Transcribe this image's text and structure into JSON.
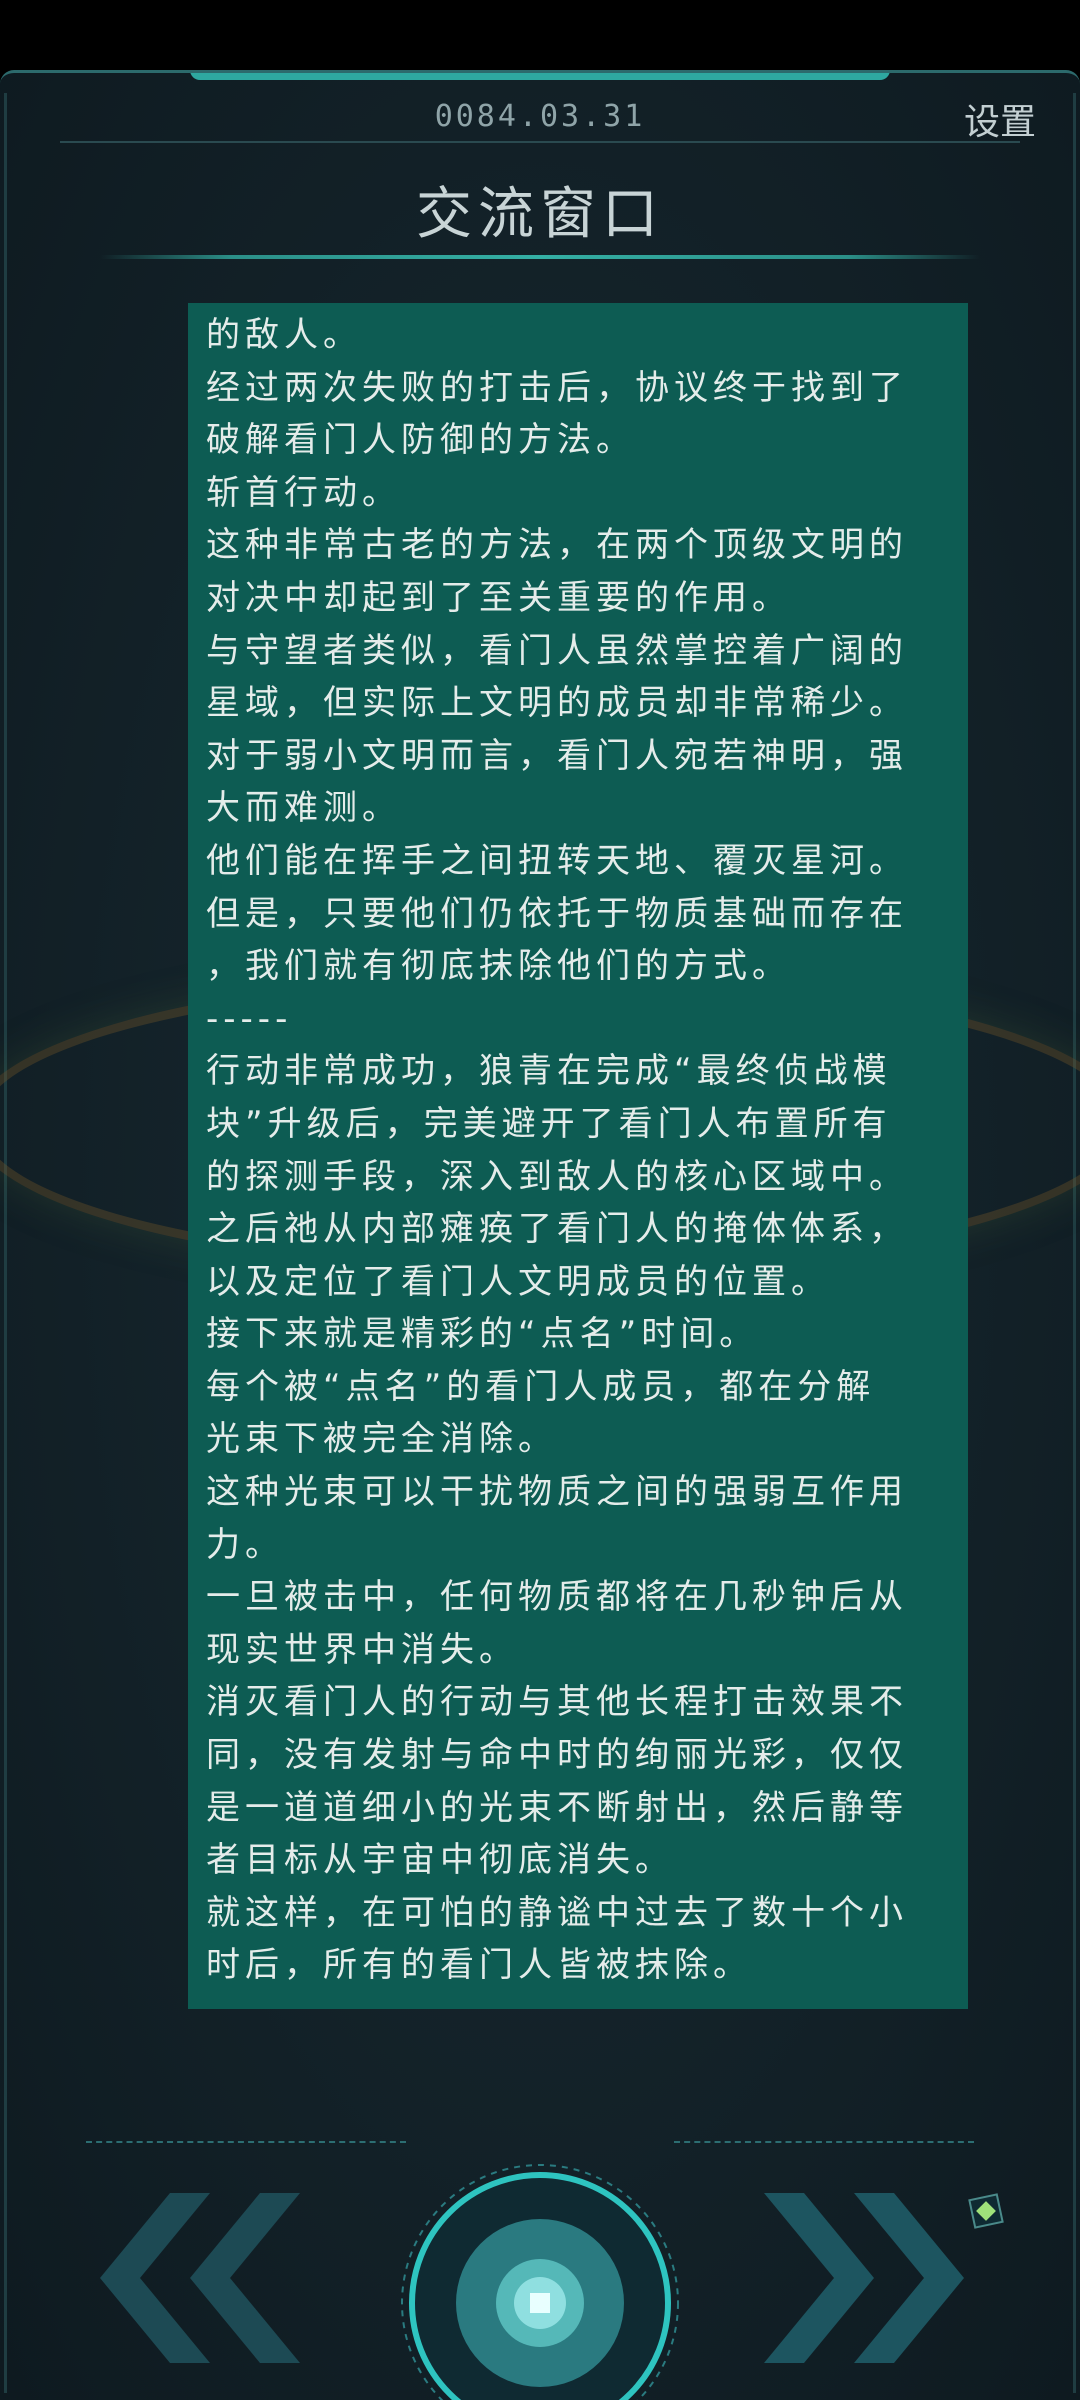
{
  "header": {
    "date": "0084.03.31",
    "settings_label": "设置",
    "title": "交流窗口"
  },
  "story": {
    "lines": [
      "的敌人。",
      "经过两次失败的打击后，协议终于找到了",
      "破解看门人防御的方法。",
      "斩首行动。",
      "这种非常古老的方法，在两个顶级文明的",
      "对决中却起到了至关重要的作用。",
      "与守望者类似，看门人虽然掌控着广阔的",
      "星域，但实际上文明的成员却非常稀少。",
      "对于弱小文明而言，看门人宛若神明，强",
      "大而难测。",
      "他们能在挥手之间扭转天地、覆灭星河。",
      "但是，只要他们仍依托于物质基础而存在",
      "，我们就有彻底抹除他们的方式。",
      "-----",
      "行动非常成功，狼青在完成“最终侦战模",
      "块”升级后，完美避开了看门人布置所有",
      "的探测手段，深入到敌人的核心区域中。",
      "之后祂从内部瘫痪了看门人的掩体体系，",
      "以及定位了看门人文明成员的位置。",
      "接下来就是精彩的“点名”时间。",
      "每个被“点名”的看门人成员，都在分解",
      "光束下被完全消除。",
      "这种光束可以干扰物质之间的强弱互作用",
      "力。",
      "一旦被击中，任何物质都将在几秒钟后从",
      "现实世界中消失。",
      "消灭看门人的行动与其他长程打击效果不",
      "同，没有发射与命中时的绚丽光彩，仅仅",
      "是一道道细小的光束不断射出，然后静等",
      "者目标从宇宙中彻底消失。",
      "就这样，在可怕的静谧中过去了数十个小",
      "时后，所有的看门人皆被抹除。"
    ]
  },
  "controls": {
    "prev_icon": "double-chevron-left-icon",
    "next_icon": "double-chevron-right-icon",
    "center_icon": "record-circle-icon",
    "corner_icon": "diamond-icon"
  },
  "colors": {
    "panel": "#0d5c53",
    "accent": "#34b0a5",
    "text": "#e4ecea",
    "background": "#14232a"
  }
}
